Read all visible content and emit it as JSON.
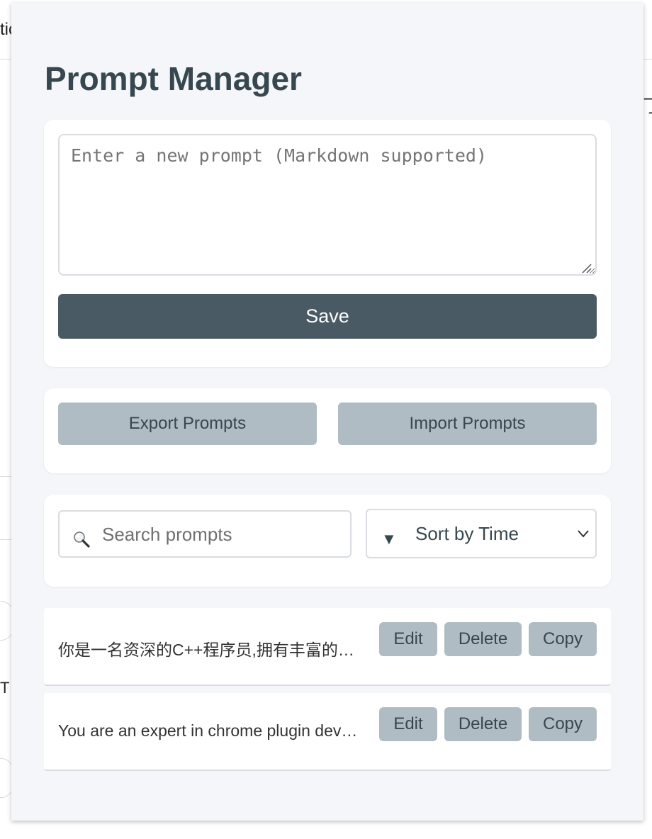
{
  "background": {
    "left_text": "tic",
    "right_text": "门",
    "side_letter": "T"
  },
  "popup": {
    "title": "Prompt Manager",
    "new_prompt": {
      "placeholder": "Enter a new prompt (Markdown supported)",
      "value": "",
      "save_label": "Save"
    },
    "io": {
      "export_label": "Export Prompts",
      "import_label": "Import Prompts"
    },
    "search": {
      "placeholder": "Search prompts",
      "value": "",
      "icon": "magnifier-icon"
    },
    "sort": {
      "icon": "triangle-down",
      "selected": "Sort by Time"
    },
    "prompts": [
      {
        "text": "你是一名资深的C++程序员,拥有丰富的开发经验",
        "edit_label": "Edit",
        "delete_label": "Delete",
        "copy_label": "Copy"
      },
      {
        "text": "You are an expert in chrome plugin development",
        "edit_label": "Edit",
        "delete_label": "Delete",
        "copy_label": "Copy"
      }
    ]
  },
  "colors": {
    "popup_bg": "#f4f6f9",
    "title": "#37474f",
    "primary_button": "#4a5a64",
    "secondary_button": "#b0bcc4"
  }
}
